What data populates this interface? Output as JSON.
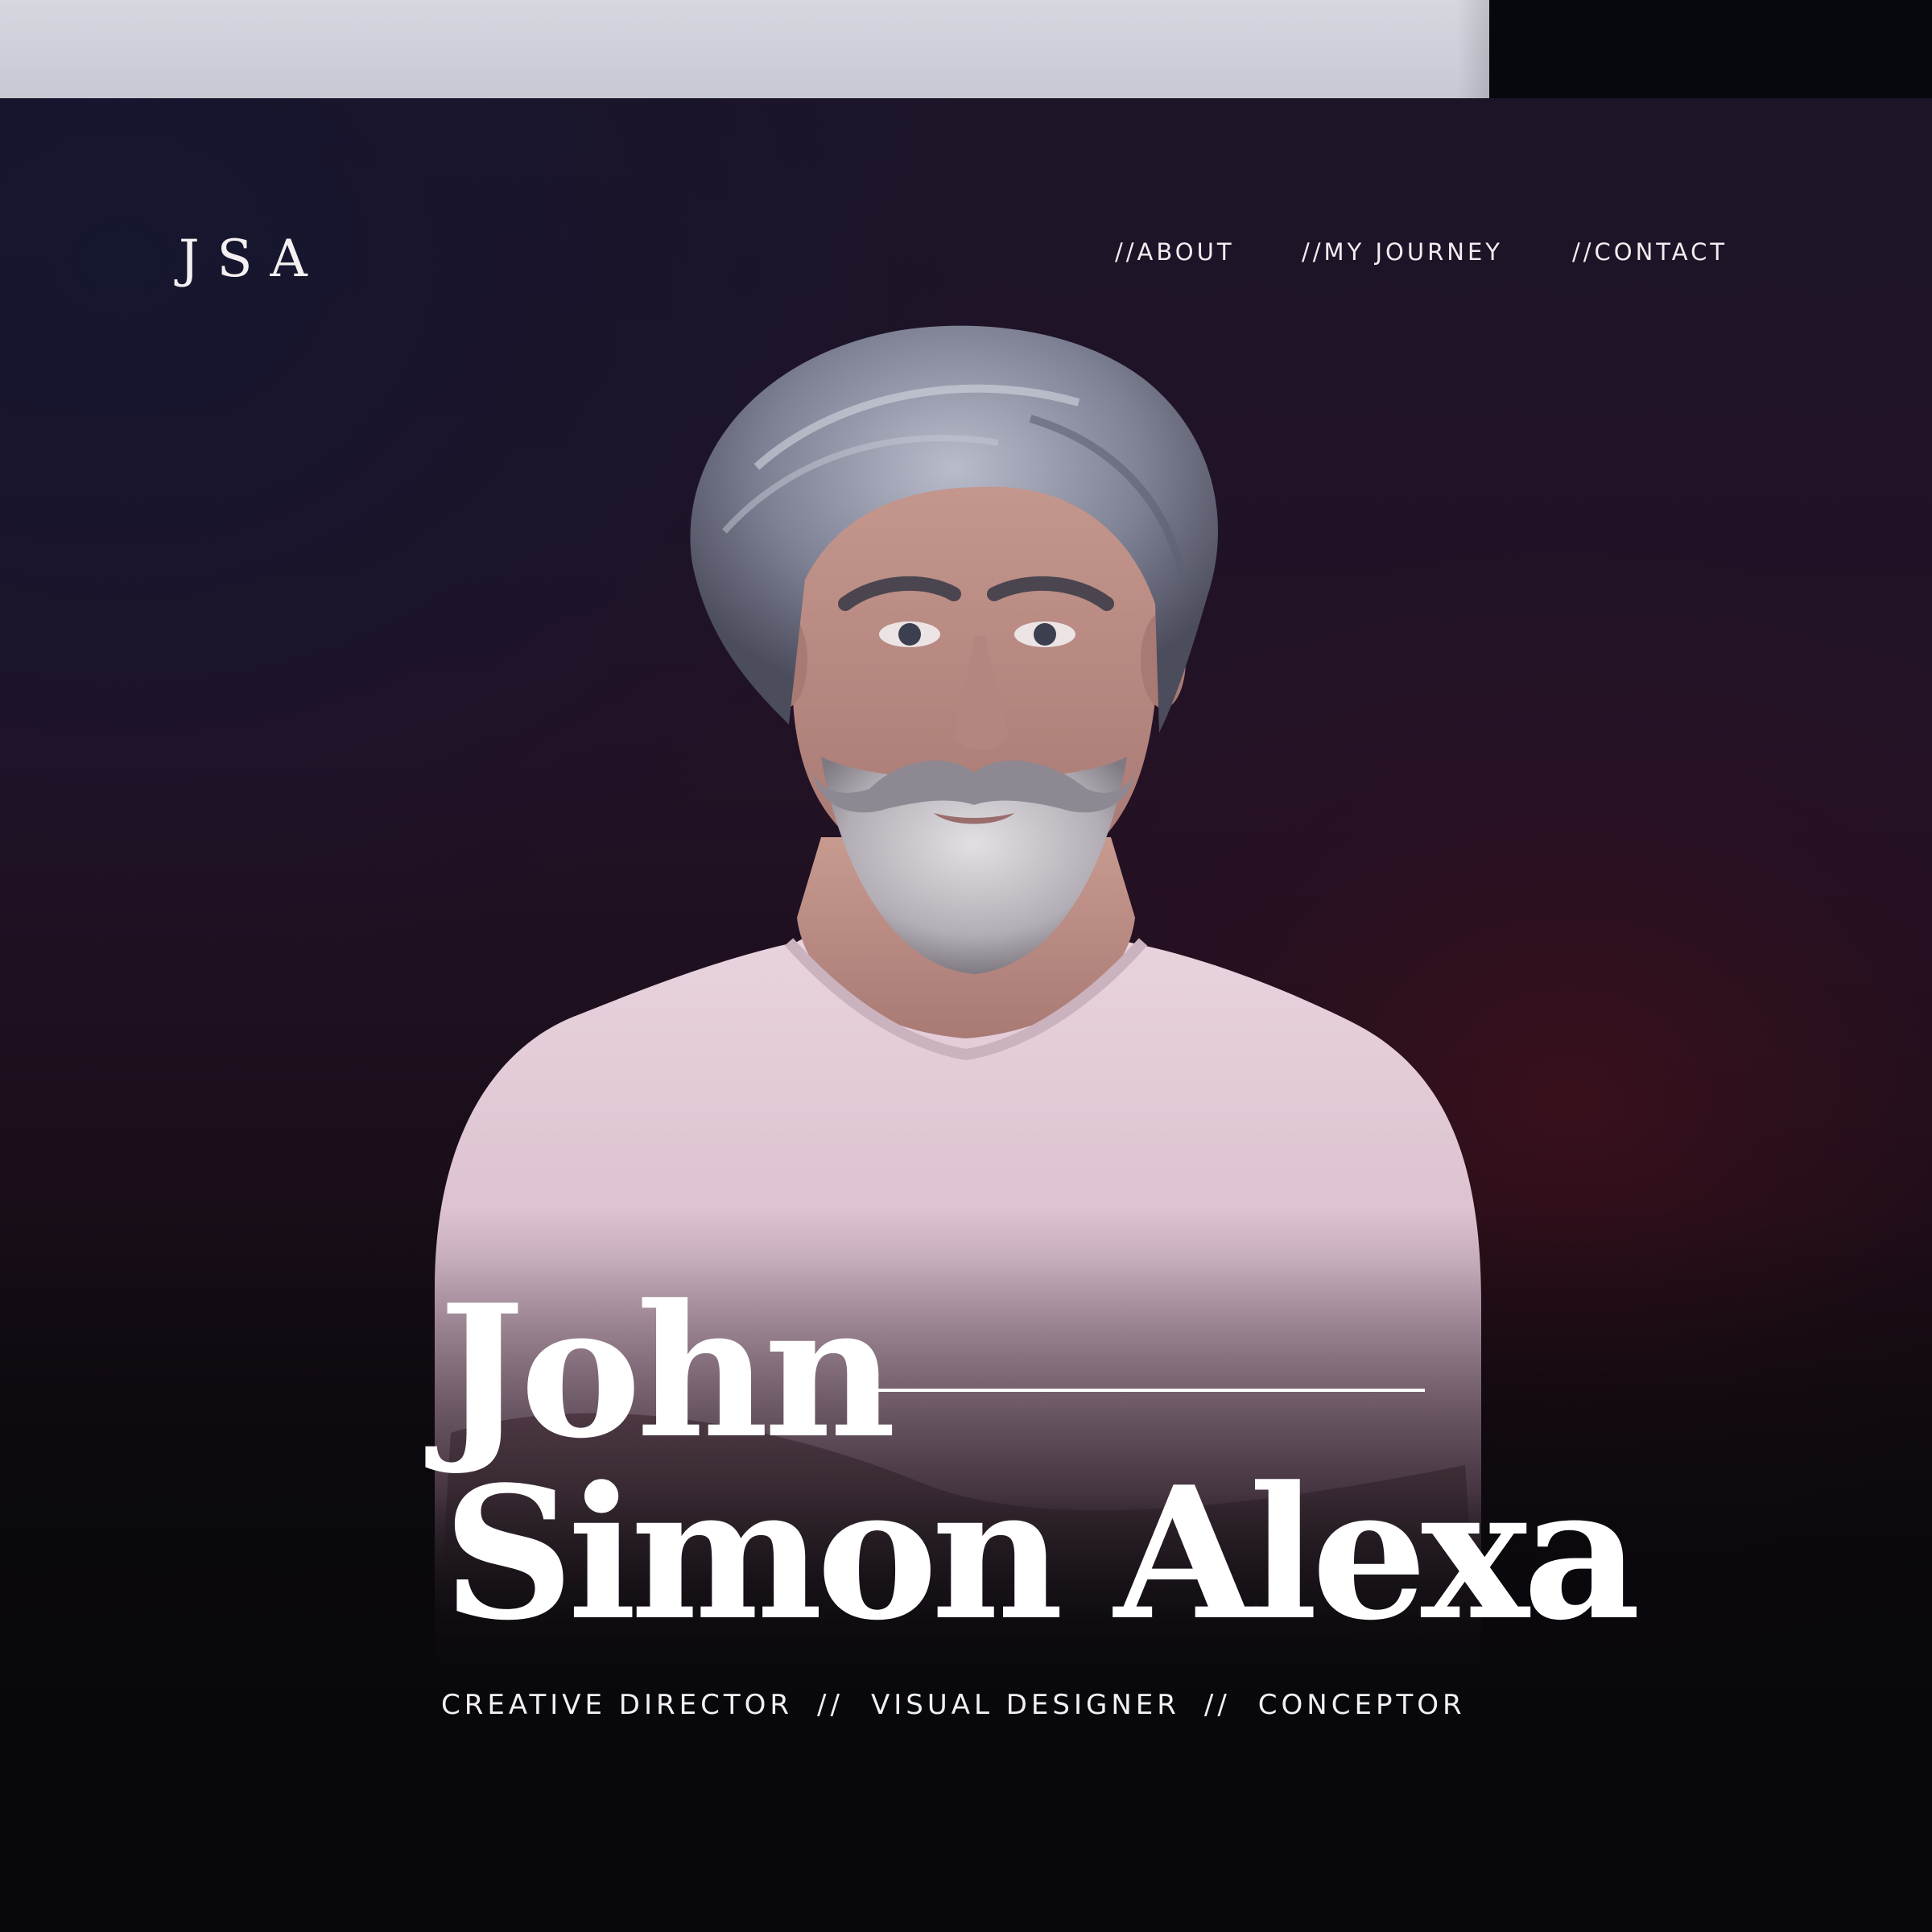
{
  "brand": {
    "logo": "JSA"
  },
  "nav": {
    "items": [
      {
        "label": "//ABOUT"
      },
      {
        "label": "//MY JOURNEY"
      },
      {
        "label": "//CONTACT"
      }
    ]
  },
  "hero": {
    "first_name": "John",
    "last_name": "Simon Alexa",
    "roles": [
      "CREATIVE DIRECTOR",
      "VISUAL DESIGNER",
      "CONCEPTOR"
    ],
    "role_separator": "//",
    "portrait": "portrait-photo"
  },
  "colors": {
    "top_strip_light": "#c9cad5",
    "top_strip_dark": "#07080d",
    "background": "#1d1428",
    "text": "#ffffff",
    "shirt": "#e6cfdb",
    "hair": "#9ea2b4"
  }
}
